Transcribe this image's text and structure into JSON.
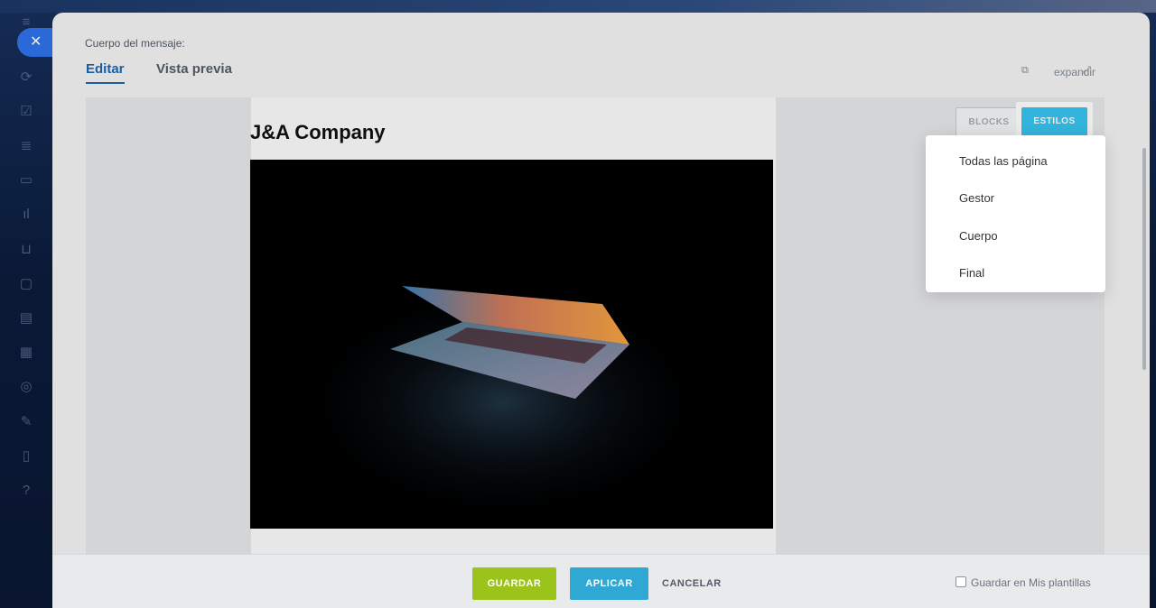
{
  "modal": {
    "body_label": "Cuerpo del mensaje:",
    "tabs": [
      {
        "label": "Editar",
        "active": true
      },
      {
        "label": "Vista previa",
        "active": false
      }
    ],
    "expand_label": "expandir"
  },
  "editor": {
    "company_title": "J&A Company",
    "blocks_button": "BLOCKS",
    "styles_button": "ESTILOS"
  },
  "styles_menu": {
    "items": [
      "Todas las página",
      "Gestor",
      "Cuerpo",
      "Final"
    ]
  },
  "footer": {
    "save": "GUARDAR",
    "apply": "APLICAR",
    "cancel": "CANCELAR",
    "save_template": "Guardar en Mis plantillas"
  },
  "colors": {
    "accent": "#2066b0",
    "styles_button": "#38c4ef",
    "save_button": "#9bc31b",
    "apply_button": "#2fa8d4"
  },
  "sidebar": {
    "icons": [
      "menu-icon",
      "chat-icon",
      "tasks-icon",
      "funnel-icon",
      "inbox-icon",
      "analytics-icon",
      "cart-icon",
      "messages-icon",
      "calendar-icon",
      "building-icon",
      "marketing-icon",
      "pencil-icon",
      "document-icon",
      "help-icon"
    ]
  }
}
